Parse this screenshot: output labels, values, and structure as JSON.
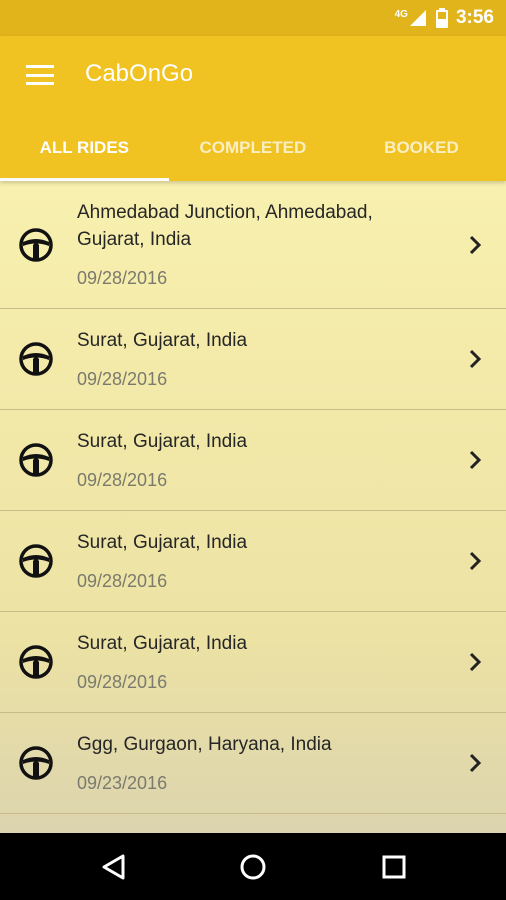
{
  "status_bar": {
    "network": "4G",
    "time": "3:56"
  },
  "app": {
    "title": "CabOnGo"
  },
  "tabs": [
    {
      "label": "ALL RIDES",
      "active": true
    },
    {
      "label": "COMPLETED",
      "active": false
    },
    {
      "label": "BOOKED",
      "active": false
    }
  ],
  "rides": [
    {
      "address": "Ahmedabad Junction, Ahmedabad, Gujarat, India",
      "date": "09/28/2016",
      "icon": "steering-wheel-icon"
    },
    {
      "address": "Surat, Gujarat, India",
      "date": "09/28/2016",
      "icon": "steering-wheel-icon"
    },
    {
      "address": "Surat, Gujarat, India",
      "date": "09/28/2016",
      "icon": "steering-wheel-icon"
    },
    {
      "address": "Surat, Gujarat, India",
      "date": "09/28/2016",
      "icon": "steering-wheel-icon"
    },
    {
      "address": "Surat, Gujarat, India",
      "date": "09/28/2016",
      "icon": "steering-wheel-icon"
    },
    {
      "address": "Ggg, Gurgaon, Haryana, India",
      "date": "09/23/2016",
      "icon": "steering-wheel-icon"
    }
  ],
  "colors": {
    "status_bar": "#e2b41c",
    "app_bar": "#f0c222",
    "list_bg": "#f5eca6",
    "nav_bar": "#000000"
  }
}
